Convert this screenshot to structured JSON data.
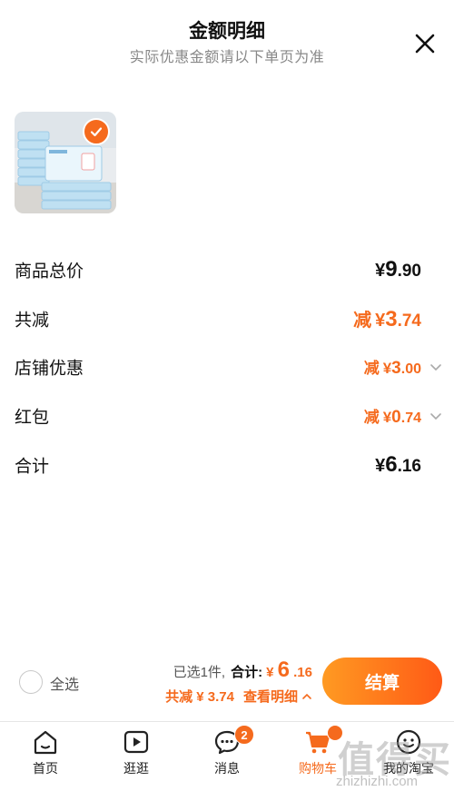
{
  "header": {
    "title": "金额明细",
    "subtitle": "实际优惠金额请以下单页为准"
  },
  "rows": [
    {
      "label": "商品总价",
      "prefix": "",
      "yen": "¥",
      "int": "9",
      "dec": ".90"
    },
    {
      "label": "共减",
      "prefix": "减",
      "yen": "¥",
      "int": "3",
      "dec": ".74"
    },
    {
      "label": "店铺优惠",
      "prefix": "减",
      "yen": "¥",
      "int": "3",
      "dec": ".00"
    },
    {
      "label": "红包",
      "prefix": "减",
      "yen": "¥",
      "int": "0",
      "dec": ".74"
    },
    {
      "label": "合计",
      "prefix": "",
      "yen": "¥",
      "int": "6",
      "dec": ".16"
    }
  ],
  "footer": {
    "select_all": "全选",
    "selected_count": "已选1件,",
    "total_label": "合计:",
    "total_yen": "¥",
    "total_int": "6",
    "total_dec": ".16",
    "discount_text": "共减 ¥ 3.74",
    "view_detail": "查看明细",
    "checkout": "结算"
  },
  "tabs": [
    {
      "label": "首页",
      "icon": "home-icon"
    },
    {
      "label": "逛逛",
      "icon": "play-icon"
    },
    {
      "label": "消息",
      "icon": "message-icon",
      "badge": "2"
    },
    {
      "label": "购物车",
      "icon": "cart-icon",
      "active": true
    },
    {
      "label": "我的淘宝",
      "icon": "taobao-face-icon"
    }
  ],
  "watermark": {
    "text": "值得买",
    "url": "zhizhizhi.com"
  },
  "colors": {
    "accent": "#f56a1d",
    "checkout_gradient_start": "#ff9a22",
    "checkout_gradient_end": "#ff5a16"
  }
}
